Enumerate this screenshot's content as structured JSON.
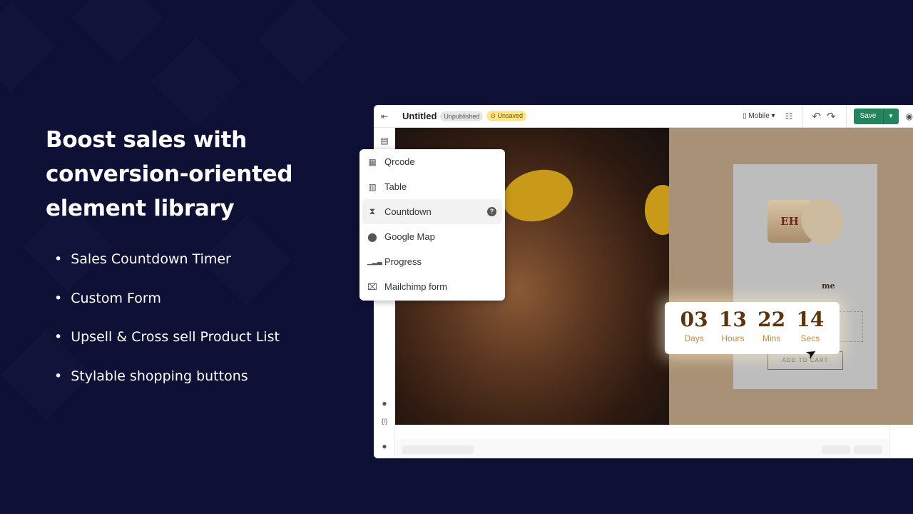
{
  "hero": {
    "title": "Boost sales with conversion-oriented element library",
    "bullets": [
      "Sales Countdown Timer",
      "Custom Form",
      "Upsell & Cross sell Product List",
      "Stylable shopping buttons"
    ]
  },
  "editor": {
    "title": "Untitled",
    "status": "Unpublished",
    "save_state": "Unsaved",
    "device": "Mobile",
    "save_label": "Save"
  },
  "menu": {
    "items": [
      {
        "label": "Qrcode",
        "icon": "qrcode-icon"
      },
      {
        "label": "Table",
        "icon": "table-icon"
      },
      {
        "label": "Countdown",
        "icon": "hourglass-icon",
        "selected": true
      },
      {
        "label": "Google Map",
        "icon": "map-pin-icon"
      },
      {
        "label": "Progress",
        "icon": "progress-bars-icon"
      },
      {
        "label": "Mailchimp form",
        "icon": "form-icon"
      }
    ]
  },
  "countdown": {
    "units": [
      {
        "value": "03",
        "label": "Days"
      },
      {
        "value": "13",
        "label": "Hours"
      },
      {
        "value": "22",
        "label": "Mins"
      },
      {
        "value": "14",
        "label": "Secs"
      }
    ]
  },
  "product": {
    "name_fragment": "me",
    "cta": "ADD TO CART",
    "logo": "EH"
  },
  "colors": {
    "background": "#0e1035",
    "save": "#23855e",
    "countdown_number": "#5b3410",
    "countdown_label": "#c08a43"
  }
}
